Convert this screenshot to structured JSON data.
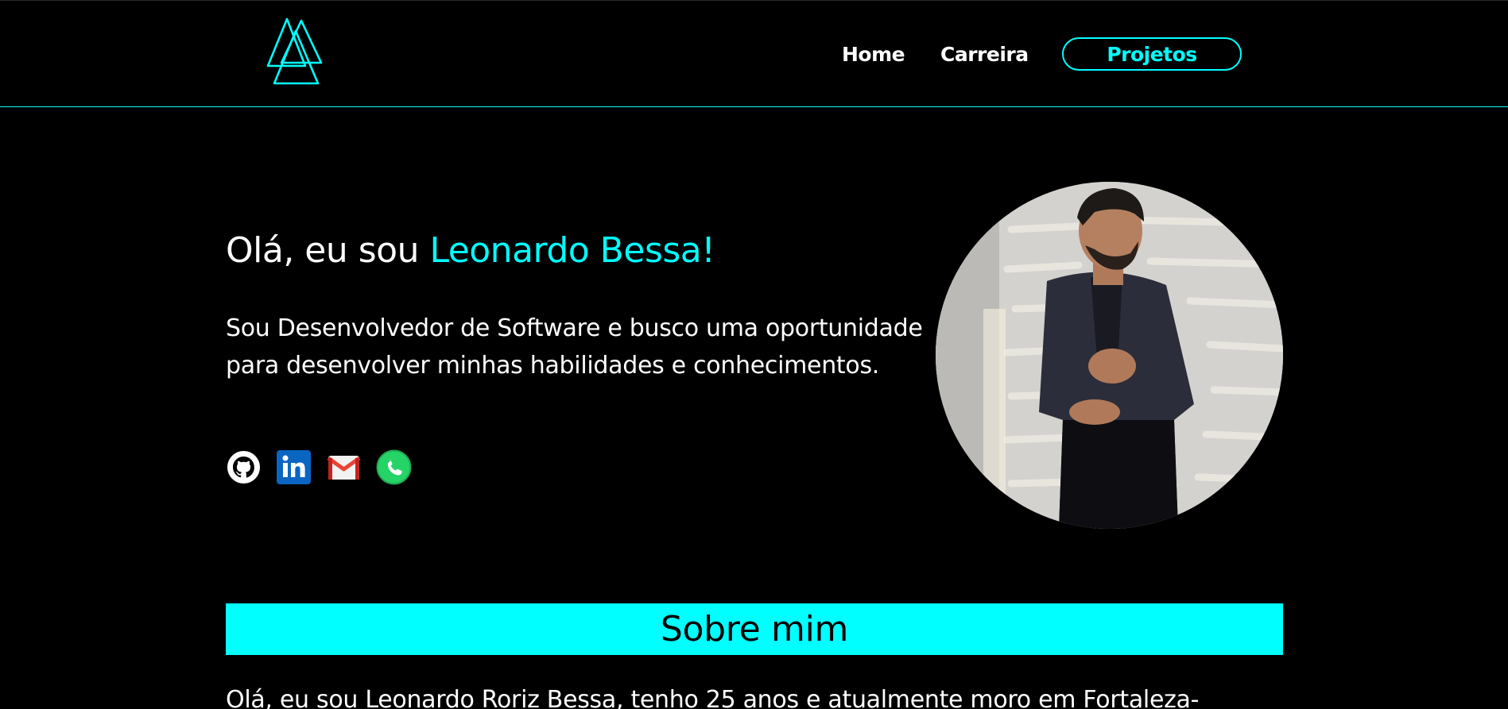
{
  "nav": {
    "home_label": "Home",
    "career_label": "Carreira",
    "projects_label": "Projetos"
  },
  "hero": {
    "title_prefix": "Olá, eu sou ",
    "title_name": "Leonardo Bessa!",
    "description": "Sou Desenvolvedor de Software e busco uma oportunidade para desenvolver minhas habilidades e conhecimentos."
  },
  "socials": [
    {
      "icon": "github-icon"
    },
    {
      "icon": "linkedin-icon"
    },
    {
      "icon": "gmail-icon"
    },
    {
      "icon": "whatsapp-icon"
    }
  ],
  "about": {
    "heading": "Sobre mim",
    "text": "Olá, eu sou Leonardo Roriz Bessa, tenho 25 anos e atualmente moro em Fortaleza-"
  },
  "colors": {
    "accent": "#00FFFF",
    "background": "#000000",
    "text": "#FFFFFF"
  }
}
